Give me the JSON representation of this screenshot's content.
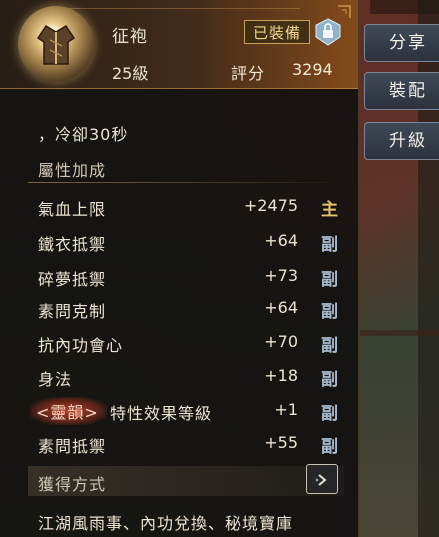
{
  "item": {
    "name": "征袍",
    "level": "25級",
    "score_label": "評分",
    "score_value": "3294",
    "status_badge": "已裝備",
    "icon": "armor-robe-icon"
  },
  "cooldown": "，冷卻30秒",
  "attributes_section": {
    "title": "屬性加成",
    "rows": [
      {
        "name": "氣血上限",
        "value": "+2475",
        "tag": "主"
      },
      {
        "name": "鐵衣抵禦",
        "value": "+64",
        "tag": "副"
      },
      {
        "name": "碎夢抵禦",
        "value": "+73",
        "tag": "副"
      },
      {
        "name": "素問克制",
        "value": "+64",
        "tag": "副"
      },
      {
        "name": "抗內功會心",
        "value": "+70",
        "tag": "副"
      },
      {
        "name": "身法",
        "value": "+18",
        "tag": "副"
      },
      {
        "name_prefix": "<靈韻>",
        "name": "特性效果等級",
        "value": "+1",
        "tag": "副"
      },
      {
        "name": "素問抵禦",
        "value": "+55",
        "tag": "副"
      }
    ]
  },
  "source_section": {
    "title": "獲得方式",
    "text": "江湖風雨事、內功兌換、秘境寶庫"
  },
  "side_buttons": {
    "share": "分享",
    "equip": "裝配",
    "upgrade": "升級"
  },
  "colors": {
    "main_tag": "#e6c26a",
    "sub_tag": "#a7bbcf",
    "header_accent": "#96541c"
  }
}
